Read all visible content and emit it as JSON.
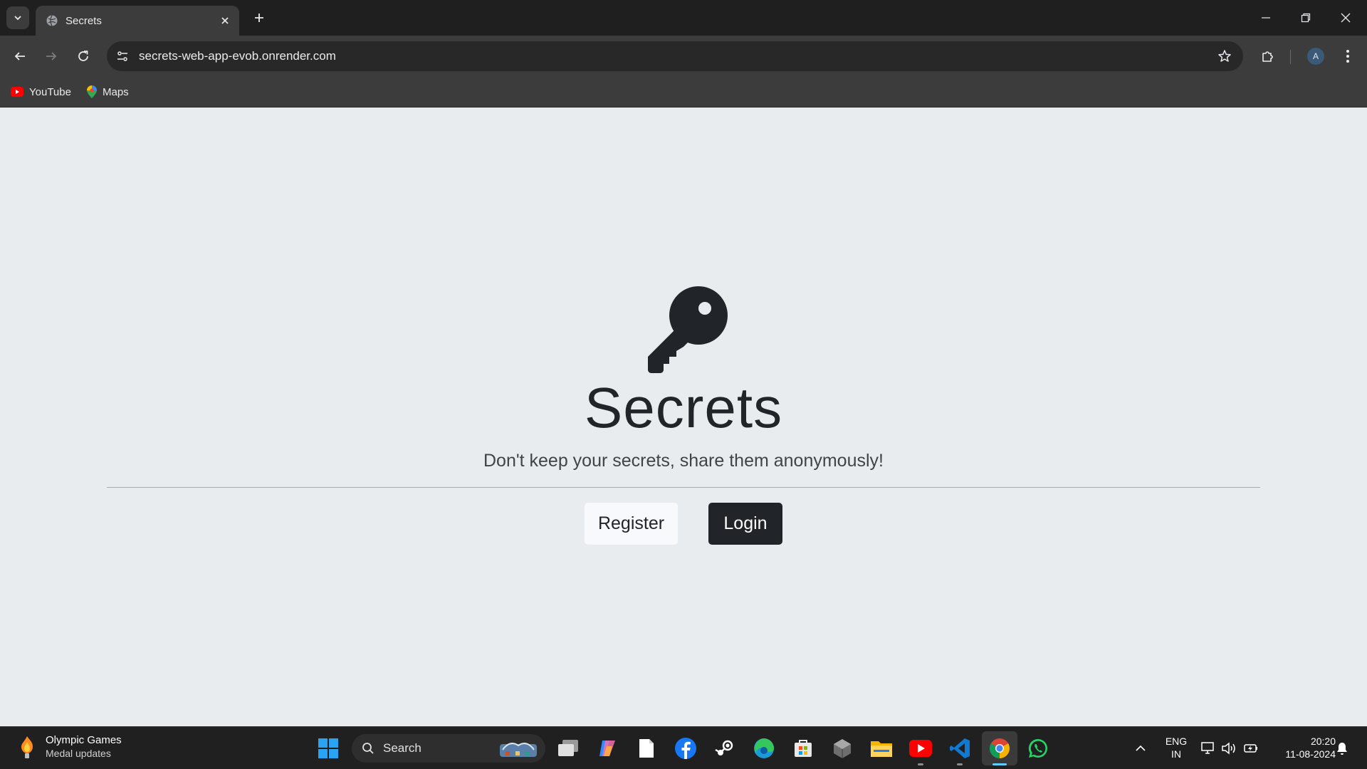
{
  "browser": {
    "tab": {
      "title": "Secrets"
    },
    "url": "secrets-web-app-evob.onrender.com",
    "profile_initial": "A",
    "bookmarks": [
      {
        "label": "YouTube"
      },
      {
        "label": "Maps"
      }
    ]
  },
  "page": {
    "title": "Secrets",
    "lead": "Don't keep your secrets, share them anonymously!",
    "register_label": "Register",
    "login_label": "Login"
  },
  "taskbar": {
    "widget": {
      "title": "Olympic Games",
      "subtitle": "Medal updates"
    },
    "search_label": "Search",
    "language": {
      "line1": "ENG",
      "line2": "IN"
    },
    "clock": {
      "time": "20:20",
      "date": "11-08-2024"
    }
  },
  "colors": {
    "page_bg": "#e9ecef",
    "text_dark": "#212529",
    "login_bg": "#212529",
    "register_bg": "#f8f9fa",
    "chrome_dark": "#1f1f1f",
    "chrome_toolbar": "#3c3c3c"
  }
}
